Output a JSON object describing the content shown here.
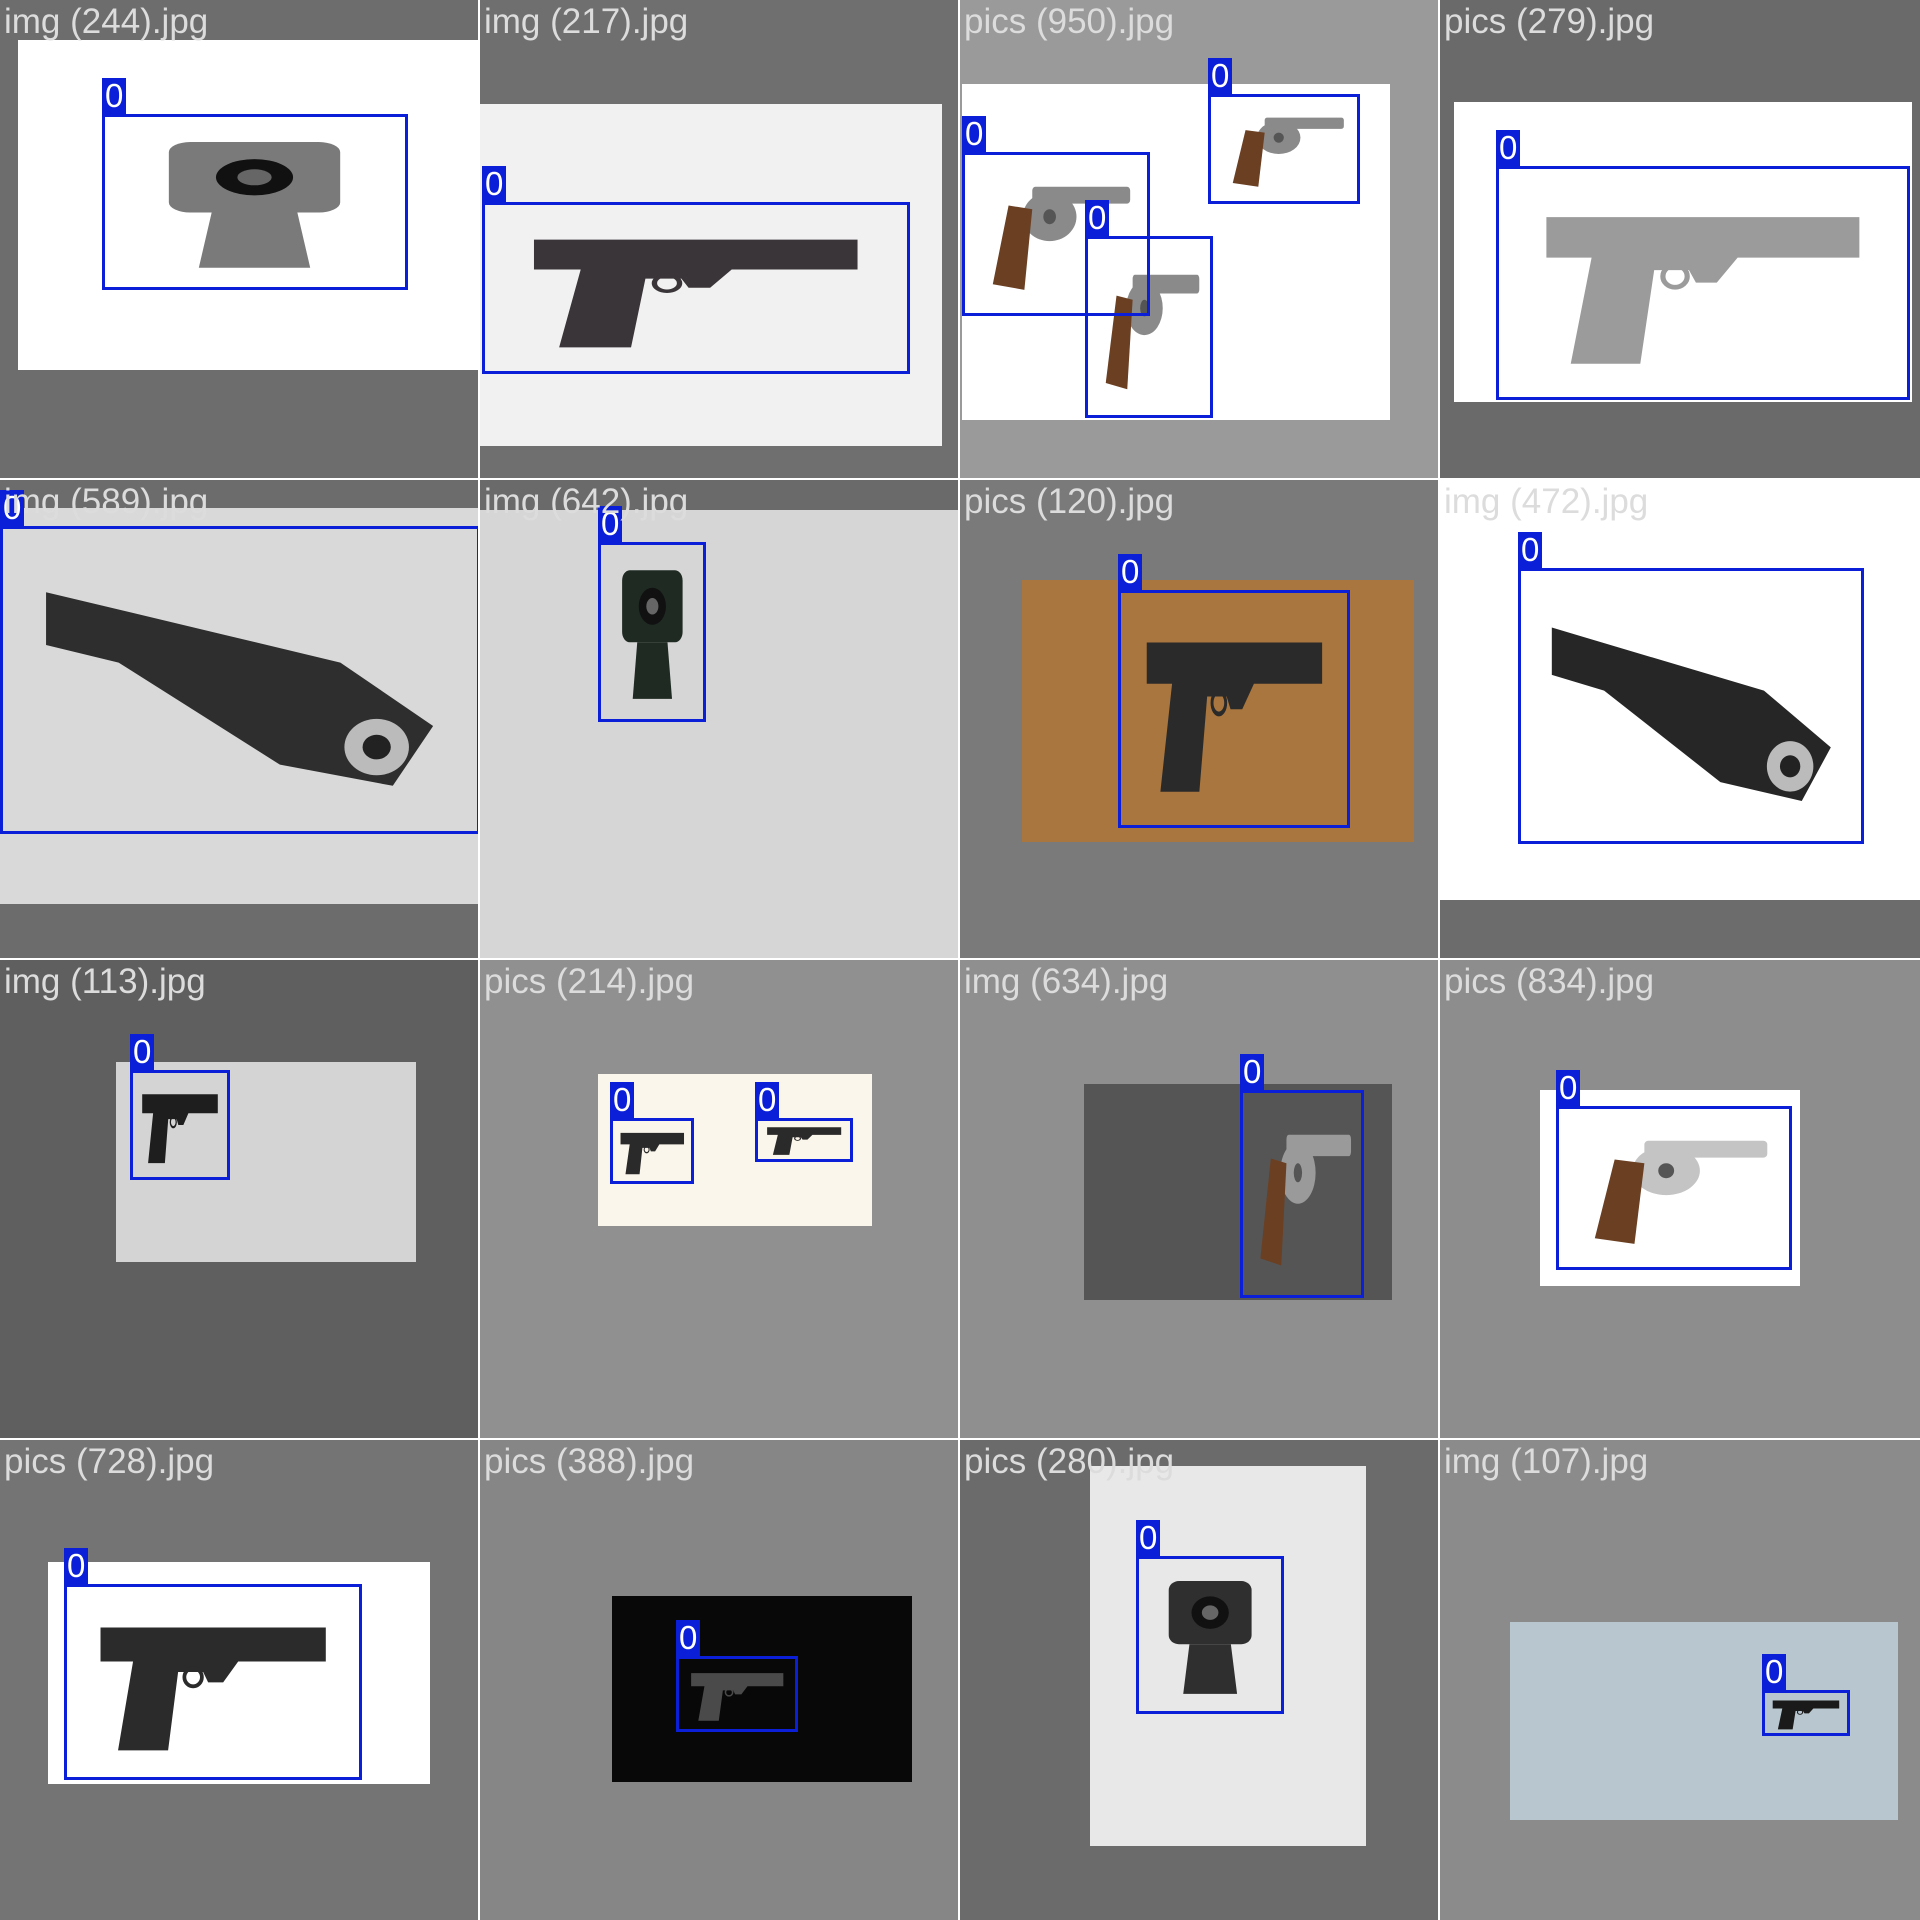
{
  "colors": {
    "box": "#0b1fd9",
    "caption_light": "#dcdcdc",
    "caption_dark": "#8a8a8a"
  },
  "tiles": [
    {
      "caption": "img (244).jpg",
      "bg": "#6d6d6d",
      "photo_bg": "#ffffff",
      "gun_color": "#7a7a7a",
      "boxes": [
        {
          "label": "0"
        }
      ]
    },
    {
      "caption": "img (217).jpg",
      "bg": "#6f6f6f",
      "photo_bg": "#f1f1f1",
      "gun_color": "#3a3538",
      "boxes": [
        {
          "label": "0"
        }
      ]
    },
    {
      "caption": "pics (950).jpg",
      "bg": "#9a9a9a",
      "photo_bg": "#ffffff",
      "gun_color": "#8a8a8a",
      "boxes": [
        {
          "label": "0"
        },
        {
          "label": "0"
        },
        {
          "label": "0"
        }
      ]
    },
    {
      "caption": "pics (279).jpg",
      "bg": "#6a6a6a",
      "photo_bg": "#ffffff",
      "gun_color": "#9b9b9b",
      "boxes": [
        {
          "label": "0"
        }
      ]
    },
    {
      "caption": "img (589).jpg",
      "bg": "#6c6c6c",
      "photo_bg": "#d9d9d9",
      "gun_color": "#2e2e2e",
      "boxes": [
        {
          "label": "0"
        }
      ]
    },
    {
      "caption": "img (642).jpg",
      "bg": "#6a6a6a",
      "photo_bg": "#d6d6d6",
      "gun_color": "#1f2a22",
      "boxes": [
        {
          "label": "0"
        }
      ]
    },
    {
      "caption": "pics (120).jpg",
      "bg": "#7a7a7a",
      "photo_bg": "#a8763e",
      "gun_color": "#2a2a2a",
      "boxes": [
        {
          "label": "0"
        }
      ]
    },
    {
      "caption": "img (472).jpg",
      "bg": "#6c6c6c",
      "photo_bg": "#ffffff",
      "gun_color": "#262626",
      "boxes": [
        {
          "label": "0"
        }
      ]
    },
    {
      "caption": "img (113).jpg",
      "bg": "#5f5f5f",
      "photo_bg": "#d4d4d4",
      "gun_color": "#1e1e1e",
      "boxes": [
        {
          "label": "0"
        }
      ]
    },
    {
      "caption": "pics (214).jpg",
      "bg": "#909090",
      "photo_bg": "#fbf6ec",
      "gun_color": "#2a2a2a",
      "boxes": [
        {
          "label": "0"
        },
        {
          "label": "0"
        }
      ]
    },
    {
      "caption": "img (634).jpg",
      "bg": "#8f8f8f",
      "photo_bg": "#555555",
      "gun_color": "#9a9a9a",
      "boxes": [
        {
          "label": "0"
        }
      ]
    },
    {
      "caption": "pics (834).jpg",
      "bg": "#8d8d8d",
      "photo_bg": "#ffffff",
      "gun_color": "#c4c4c4",
      "boxes": [
        {
          "label": "0"
        }
      ]
    },
    {
      "caption": "pics (728).jpg",
      "bg": "#747474",
      "photo_bg": "#ffffff",
      "gun_color": "#2b2b2b",
      "boxes": [
        {
          "label": "0"
        }
      ]
    },
    {
      "caption": "pics (388).jpg",
      "bg": "#868686",
      "photo_bg": "#080808",
      "gun_color": "#4a4a4a",
      "boxes": [
        {
          "label": "0"
        }
      ]
    },
    {
      "caption": "pics (280).jpg",
      "bg": "#6b6b6b",
      "photo_bg": "#e8e8e8",
      "gun_color": "#2f2f2f",
      "boxes": [
        {
          "label": "0"
        }
      ]
    },
    {
      "caption": "img (107).jpg",
      "bg": "#8b8b8b",
      "photo_bg": "#b8c6cf",
      "gun_color": "#1a1a1a",
      "boxes": [
        {
          "label": "0"
        }
      ]
    }
  ]
}
